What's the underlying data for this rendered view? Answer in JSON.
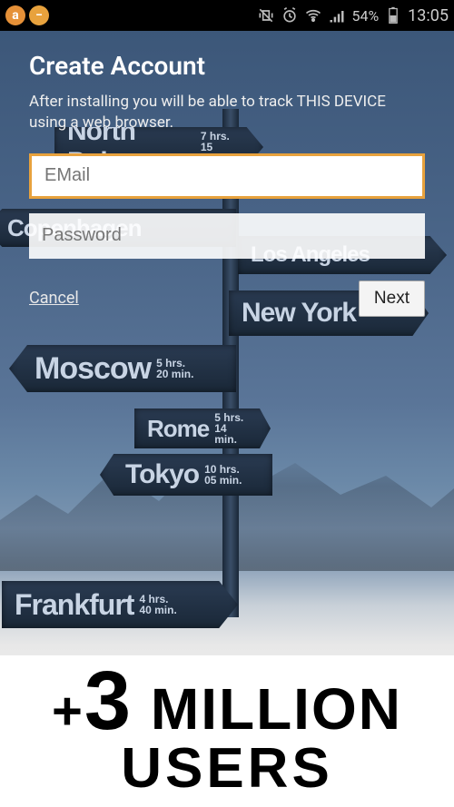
{
  "statusbar": {
    "battery_pct": "54%",
    "time": "13:05"
  },
  "form": {
    "title": "Create Account",
    "subtitle": "After installing you will be able to track THIS DEVICE using a web browser.",
    "email_placeholder": "EMail",
    "password_placeholder": "Password",
    "cancel_label": "Cancel",
    "next_label": "Next"
  },
  "promo": {
    "line1_prefix": "+",
    "line1_number": "3",
    "line1_word": "MILLION",
    "line2": "USERS"
  },
  "signs": {
    "northpole": "North Pole",
    "copenhagen": "Copenhagen",
    "newyork": "New York",
    "la": "Los Angeles",
    "moscow": "Moscow",
    "rome": "Rome",
    "tokyo": "Tokyo",
    "frankfurt": "Frankfurt"
  }
}
